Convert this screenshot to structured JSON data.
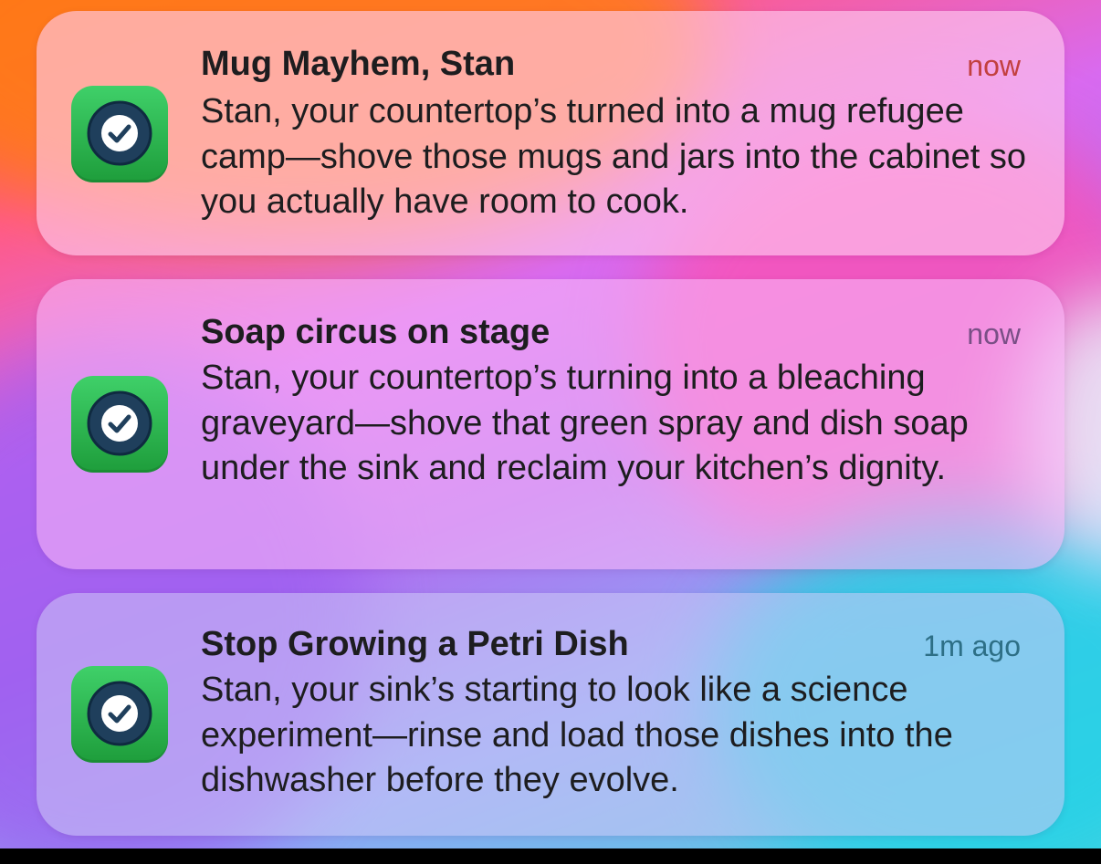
{
  "notifications": [
    {
      "title": "Mug Mayhem, Stan",
      "time": "now",
      "body": "Stan, your countertop’s turned into a mug refugee camp—shove those mugs and jars into the cabinet so you actually have room to cook.",
      "icon": "checkmark-app-icon",
      "time_color": "#c2403f"
    },
    {
      "title": "Soap circus on stage",
      "time": "now",
      "body": "Stan, your countertop’s turning into a bleaching graveyard—shove that green spray and dish soap under the sink and reclaim your kitchen’s dignity.",
      "icon": "checkmark-app-icon",
      "time_color": "#7a4f86"
    },
    {
      "title": "Stop Growing a Petri Dish",
      "time": "1m ago",
      "body": "Stan, your sink’s starting to look like a science experiment—rinse and load those dishes into the dishwasher before they evolve.",
      "icon": "checkmark-app-icon",
      "time_color": "#2d6f86"
    }
  ],
  "colors": {
    "app_icon_green": "#2bb04f",
    "app_icon_disc": "#1f3f5c"
  }
}
